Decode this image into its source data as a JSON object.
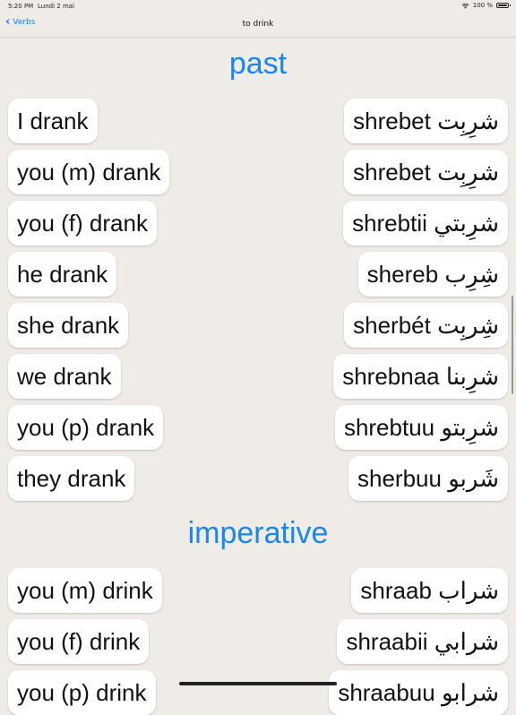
{
  "status_bar": {
    "time": "5:20 PM",
    "date": "Lundi 2 mai",
    "battery": "100 %"
  },
  "nav": {
    "back_label": "Verbs",
    "title": "to drink"
  },
  "sections": {
    "past": {
      "title": "past",
      "rows": [
        {
          "english": "I drank",
          "arabic": "shrebet شرِبِت"
        },
        {
          "english": "you (m) drank",
          "arabic": "shrebet شرِبِت"
        },
        {
          "english": "you (f) drank",
          "arabic": "shrebtii شرِبتي"
        },
        {
          "english": "he drank",
          "arabic": "shereb شِرِب"
        },
        {
          "english": "she drank",
          "arabic": "sherbét شِربِت"
        },
        {
          "english": "we drank",
          "arabic": "shrebnaa شرِبنا"
        },
        {
          "english": "you (p) drank",
          "arabic": "shrebtuu شرِبتو"
        },
        {
          "english": "they drank",
          "arabic": "sherbuu شَربو"
        }
      ]
    },
    "imperative": {
      "title": "imperative",
      "rows": [
        {
          "english": "you (m) drink",
          "arabic": "shraab شراب"
        },
        {
          "english": "you (f) drink",
          "arabic": "shraabii شرابي"
        },
        {
          "english": "you (p) drink",
          "arabic": "shraabuu شرابو"
        }
      ]
    }
  }
}
